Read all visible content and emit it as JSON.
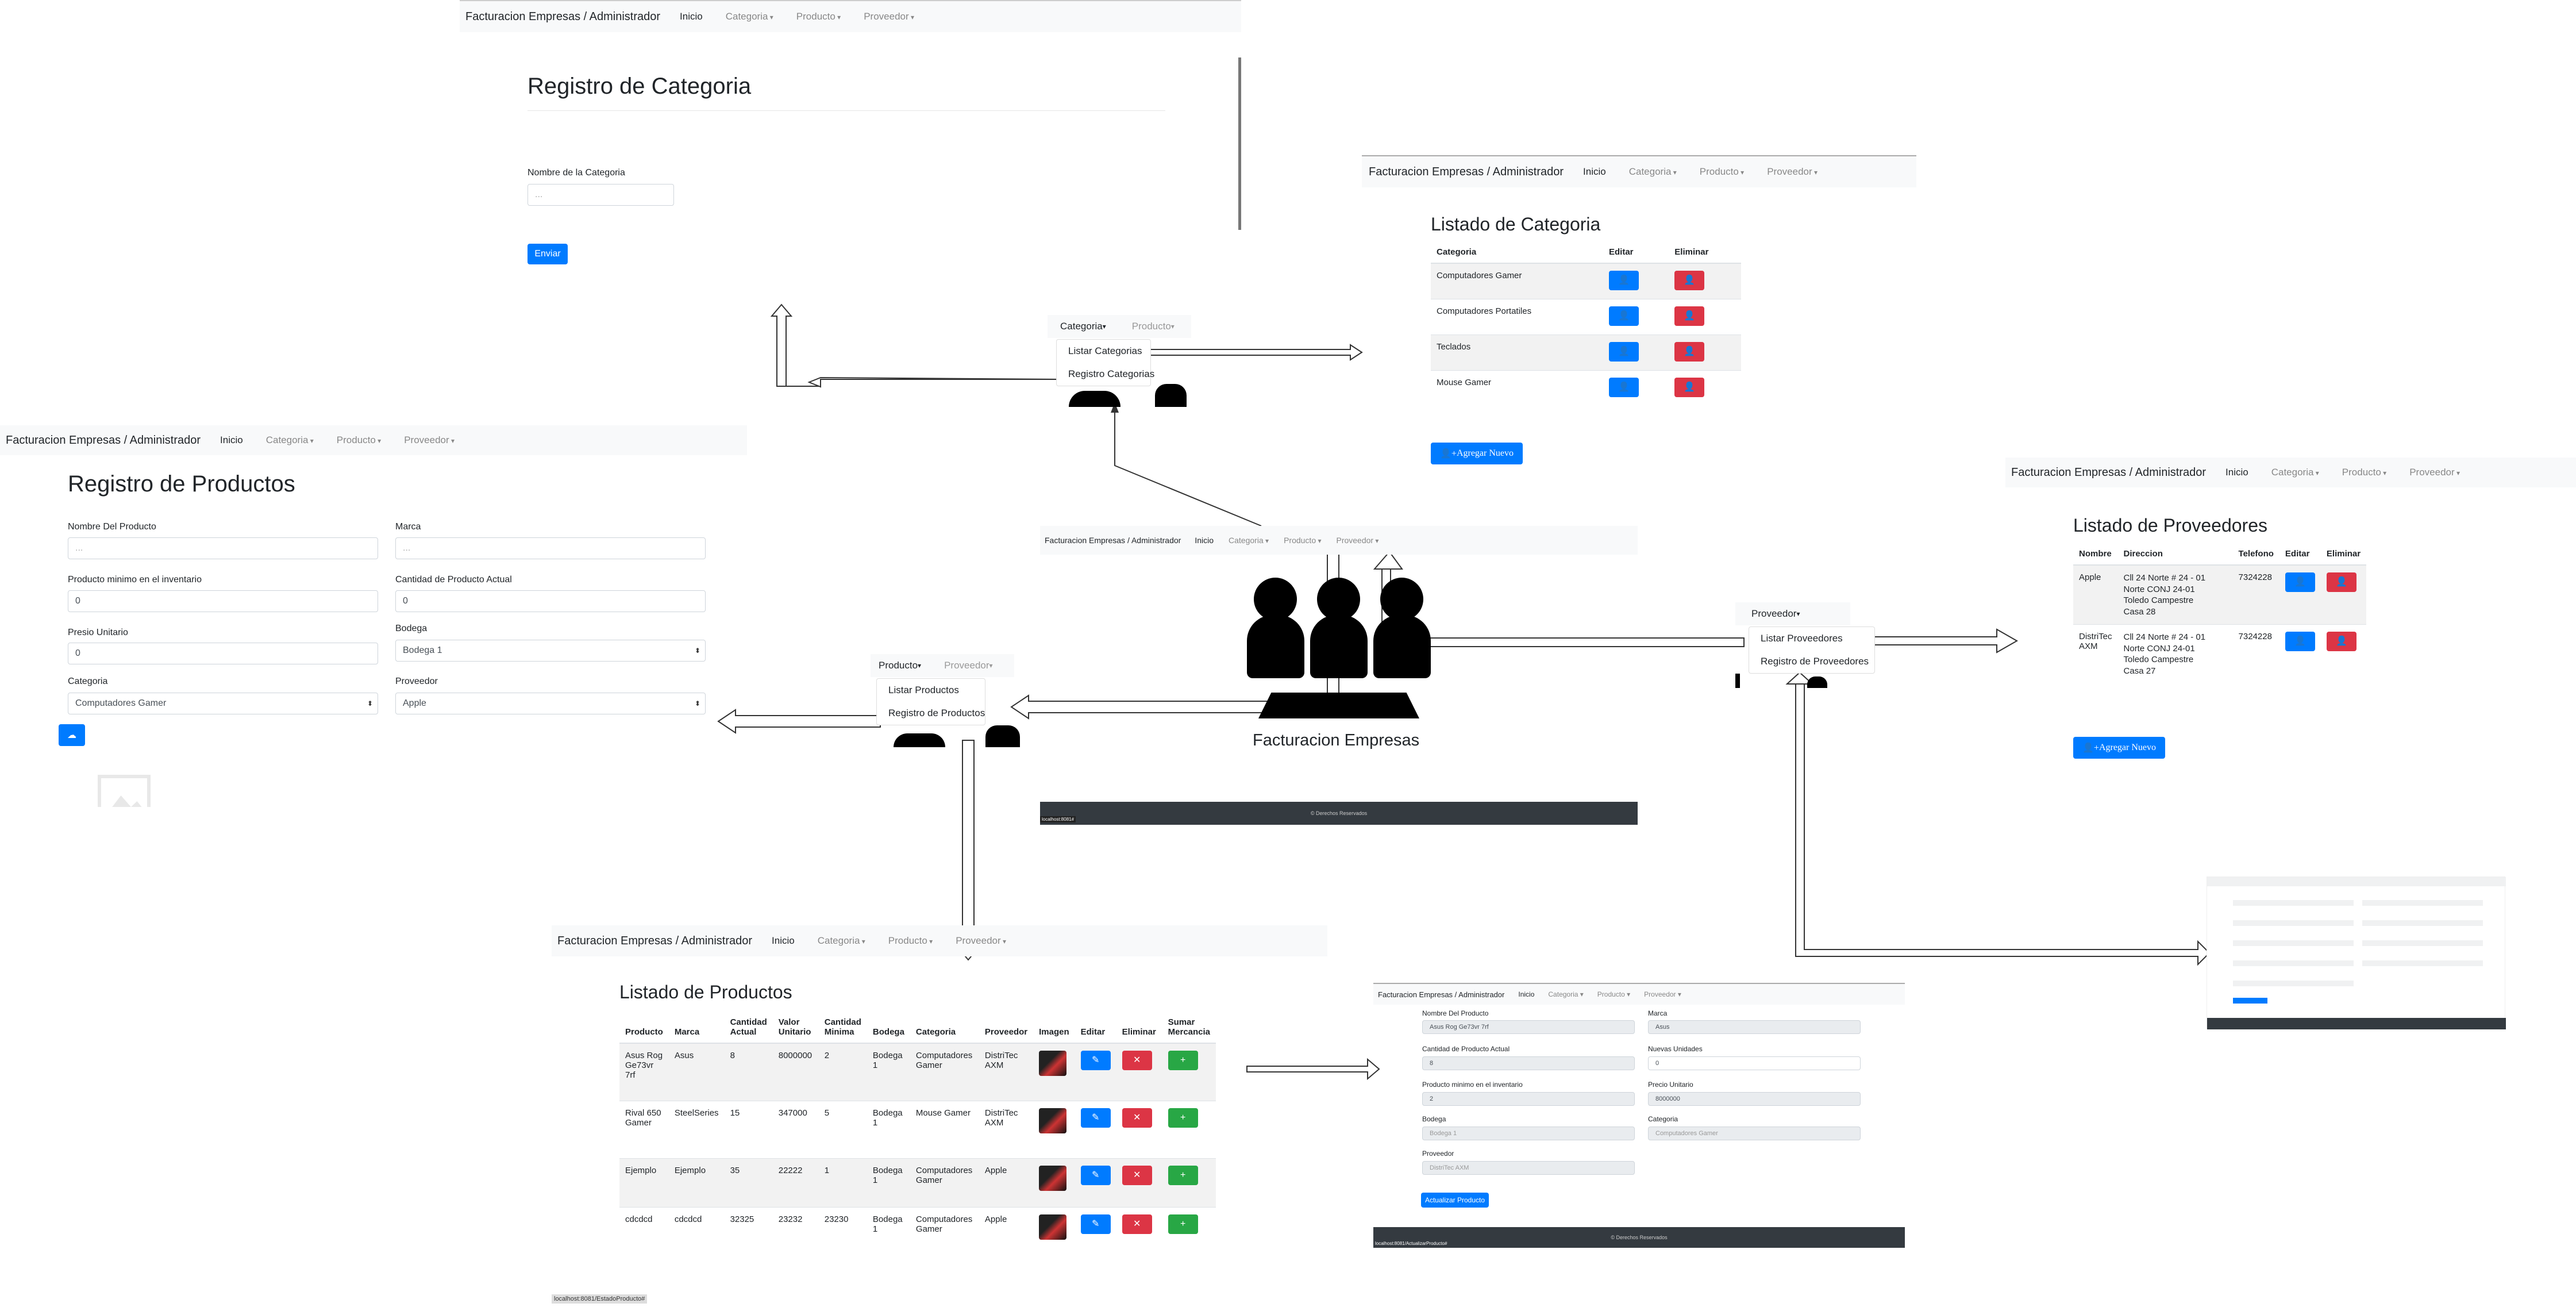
{
  "nav": {
    "brand": "Facturacion Empresas / Administrador",
    "inicio": "Inicio",
    "categoria": "Categoria",
    "producto": "Producto",
    "proveedor": "Proveedor"
  },
  "reg_categoria": {
    "title": "Registro de Categoria",
    "label": "Nombre de la Categoria",
    "placeholder": "...",
    "submit": "Enviar"
  },
  "list_categoria": {
    "title": "Listado de Categoria",
    "headers": [
      "Categoria",
      "Editar",
      "Eliminar"
    ],
    "rows": [
      "Computadores Gamer",
      "Computadores Portatiles",
      "Teclados",
      "Mouse Gamer"
    ],
    "add": "Agregar Nuevo"
  },
  "cat_menu": {
    "tab1": "Categoria",
    "tab2": "Producto",
    "items": [
      "Listar Categorias",
      "Registro Categorias"
    ]
  },
  "reg_producto": {
    "title": "Registro de Productos",
    "f_nombre": "Nombre Del Producto",
    "v_nombre": "...",
    "f_marca": "Marca",
    "v_marca": "...",
    "f_min": "Producto minimo en el inventario",
    "v_min": "0",
    "f_cant": "Cantidad de Producto Actual",
    "v_cant": "0",
    "f_precio": "Presio Unitario",
    "v_precio": "0",
    "f_bodega": "Bodega",
    "v_bodega": "Bodega 1",
    "f_cat": "Categoria",
    "v_cat": "Computadores Gamer",
    "f_prov": "Proveedor",
    "v_prov": "Apple"
  },
  "prod_menu": {
    "tab1": "Producto",
    "tab2": "Proveedor",
    "items": [
      "Listar Productos",
      "Registro de Productos"
    ]
  },
  "center": {
    "title": "Facturacion Empresas",
    "footer": "© Derechos Reservados",
    "status": "localhost:8081#"
  },
  "prov_menu": {
    "tab": "Proveedor",
    "items": [
      "Listar Proveedores",
      "Registro de Proveedores"
    ]
  },
  "list_prov": {
    "title": "Listado de Proveedores",
    "headers": [
      "Nombre",
      "Direccion",
      "Telefono",
      "Editar",
      "Eliminar"
    ],
    "rows": [
      {
        "n1": "Apple",
        "n2": "",
        "d1": "Cll 24 Norte # 24 - 01",
        "d2": "Norte CONJ 24-01",
        "d3": "Toledo Campestre",
        "d4": "Casa 28",
        "t": "7324228"
      },
      {
        "n1": "DistriTec",
        "n2": "AXM",
        "d1": "Cll 24 Norte # 24 - 01",
        "d2": "Norte CONJ 24-01",
        "d3": "Toledo Campestre",
        "d4": "Casa 27",
        "t": "7324228"
      }
    ],
    "add": "Agregar Nuevo"
  },
  "list_prod": {
    "title": "Listado de Productos",
    "headers": [
      "Producto",
      "Marca",
      "Cantidad Actual",
      "Valor Unitario",
      "Cantidad Minima",
      "Bodega",
      "Categoria",
      "Proveedor",
      "Imagen",
      "Editar",
      "Eliminar",
      "Sumar Mercancia"
    ],
    "rows": [
      {
        "p": "Asus Rog Ge73vr 7rf",
        "m": "Asus",
        "ca": "8",
        "vu": "8000000",
        "cm": "2",
        "b": "Bodega 1",
        "c": "Computadores Gamer",
        "pv": "DistriTec AXM"
      },
      {
        "p": "Rival 650 Gamer",
        "m": "SteelSeries",
        "ca": "15",
        "vu": "347000",
        "cm": "5",
        "b": "Bodega 1",
        "c": "Mouse Gamer",
        "pv": "DistriTec AXM"
      },
      {
        "p": "Ejemplo",
        "m": "Ejemplo",
        "ca": "35",
        "vu": "22222",
        "cm": "1",
        "b": "Bodega 1",
        "c": "Computadores Gamer",
        "pv": "Apple"
      },
      {
        "p": "cdcdcd",
        "m": "cdcdcd",
        "ca": "32325",
        "vu": "23232",
        "cm": "23230",
        "b": "Bodega 1",
        "c": "Computadores Gamer",
        "pv": "Apple"
      }
    ],
    "status": "localhost:8081/EstadoProducto#"
  },
  "edit_prod": {
    "f_nombre": "Nombre Del Producto",
    "v_nombre": "Asus Rog Ge73vr 7rf",
    "f_marca": "Marca",
    "v_marca": "Asus",
    "f_cant": "Cantidad de Producto Actual",
    "v_cant": "8",
    "f_nuevas": "Nuevas Unidades",
    "v_nuevas": "0",
    "f_min": "Producto minimo en el inventario",
    "v_min": "2",
    "f_precio": "Precio Unitario",
    "v_precio": "8000000",
    "f_bodega": "Bodega",
    "v_bodega": "Bodega 1",
    "f_cat": "Categoria",
    "v_cat": "Computadores Gamer",
    "f_prov": "Proveedor",
    "v_prov": "DistriTec AXM",
    "submit": "Actualizar Producto",
    "footer": "© Derechos Reservados",
    "status": "localhost:8081/ActualizarProducto#"
  },
  "colors": {
    "primary": "#007bff",
    "danger": "#dc3545",
    "success": "#28a745",
    "navbar": "#f8f9fa",
    "footer": "#343a40"
  }
}
